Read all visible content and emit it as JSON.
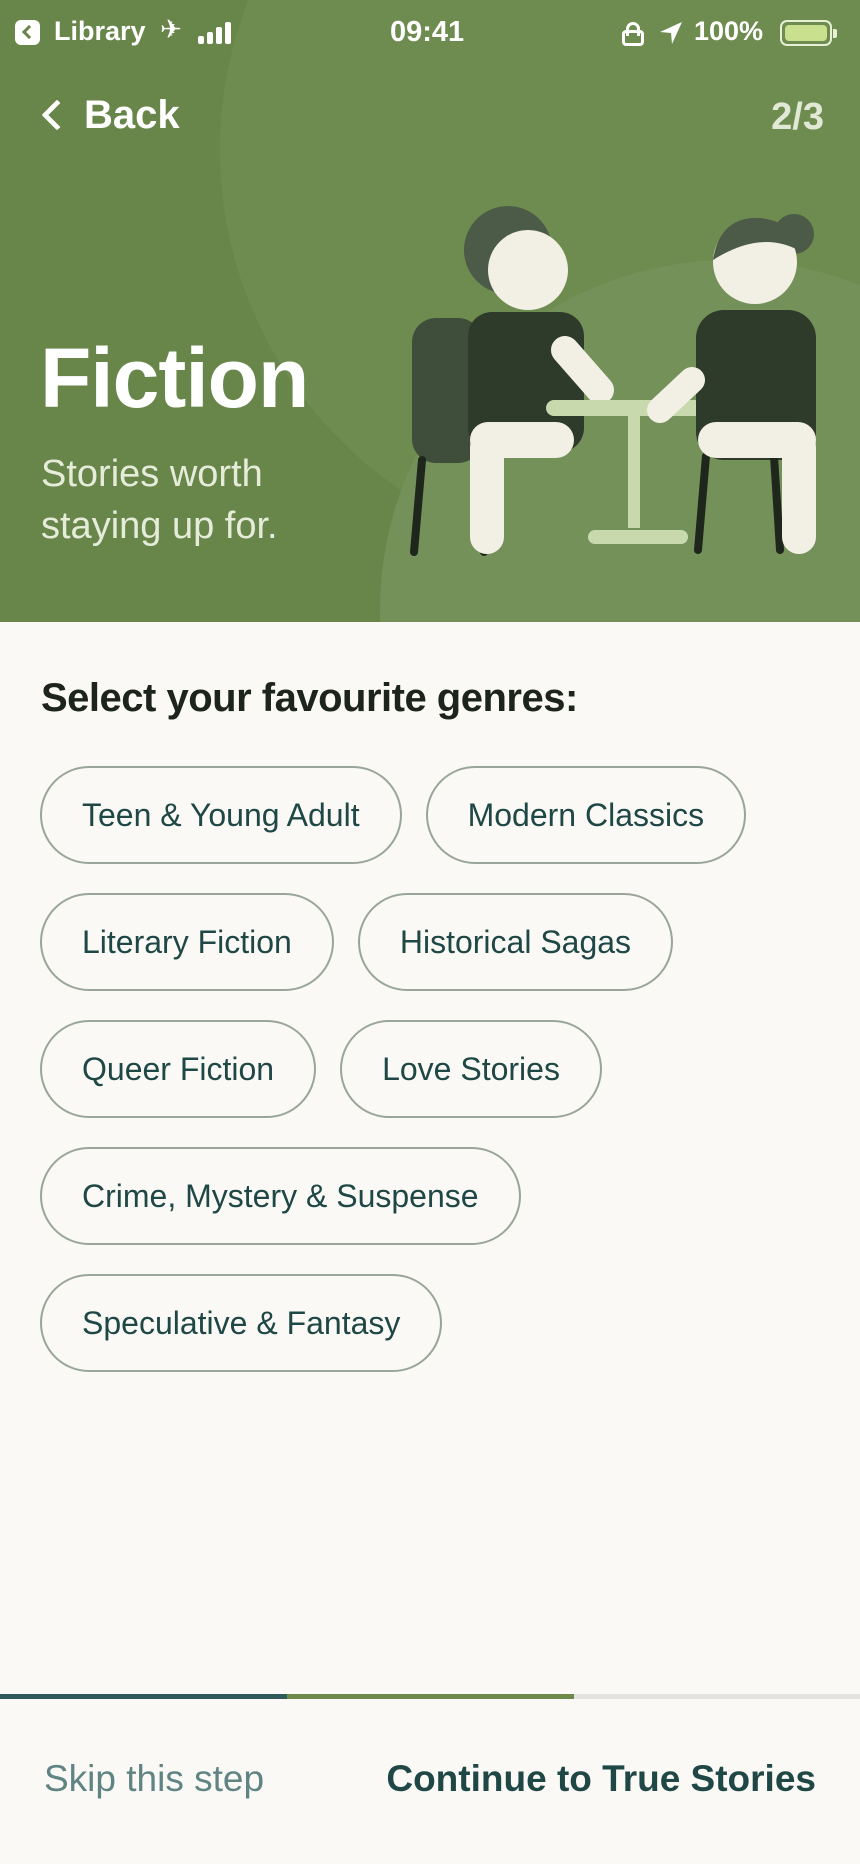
{
  "status_bar": {
    "back_app": "Library",
    "time": "09:41",
    "battery_percent": "100%"
  },
  "nav": {
    "back_label": "Back",
    "step_indicator": "2/3"
  },
  "hero": {
    "title": "Fiction",
    "subtitle": "Stories worth staying up for.",
    "background_color": "#68864a"
  },
  "section_title": "Select your favourite genres:",
  "genres": [
    [
      "Teen & Young Adult",
      "Modern Classics"
    ],
    [
      "Literary Fiction",
      "Historical Sagas"
    ],
    [
      "Queer Fiction",
      "Love Stories"
    ],
    [
      "Crime, Mystery & Suspense"
    ],
    [
      "Speculative & Fantasy"
    ]
  ],
  "progress": {
    "steps_total": 3,
    "step_current": 2
  },
  "footer": {
    "skip_label": "Skip this step",
    "continue_label": "Continue to True Stories"
  }
}
